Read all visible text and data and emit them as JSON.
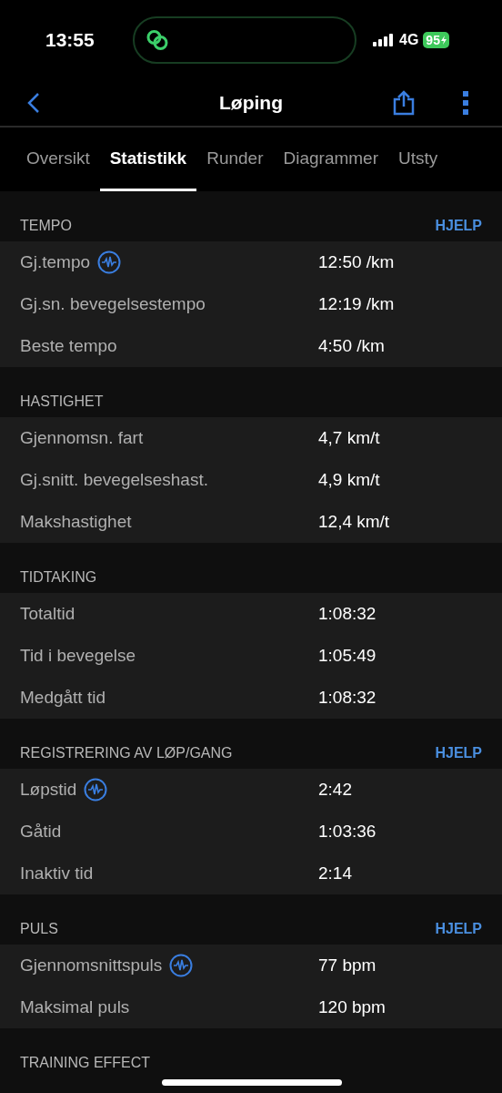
{
  "status_bar": {
    "time": "13:55",
    "network": "4G",
    "battery": "95"
  },
  "nav": {
    "title": "Løping"
  },
  "tabs": [
    {
      "label": "Oversikt",
      "selected": false
    },
    {
      "label": "Statistikk",
      "selected": true
    },
    {
      "label": "Runder",
      "selected": false
    },
    {
      "label": "Diagrammer",
      "selected": false
    },
    {
      "label": "Utsty",
      "selected": false
    }
  ],
  "sections": [
    {
      "title": "TEMPO",
      "help": "HJELP",
      "rows": [
        {
          "label": "Gj.tempo",
          "chart_icon": true,
          "value": "12:50 /km"
        },
        {
          "label": "Gj.sn. bevegelsestempo",
          "chart_icon": false,
          "value": "12:19 /km"
        },
        {
          "label": "Beste tempo",
          "chart_icon": false,
          "value": "4:50 /km"
        }
      ]
    },
    {
      "title": "HASTIGHET",
      "rows": [
        {
          "label": "Gjennomsn. fart",
          "chart_icon": false,
          "value": "4,7 km/t"
        },
        {
          "label": "Gj.snitt. bevegelseshast.",
          "chart_icon": false,
          "value": "4,9 km/t"
        },
        {
          "label": "Makshastighet",
          "chart_icon": false,
          "value": "12,4 km/t"
        }
      ]
    },
    {
      "title": "TIDTAKING",
      "rows": [
        {
          "label": "Totaltid",
          "chart_icon": false,
          "value": "1:08:32"
        },
        {
          "label": "Tid i bevegelse",
          "chart_icon": false,
          "value": "1:05:49"
        },
        {
          "label": "Medgått tid",
          "chart_icon": false,
          "value": "1:08:32"
        }
      ]
    },
    {
      "title": "REGISTRERING AV LØP/GANG",
      "help": "HJELP",
      "rows": [
        {
          "label": "Løpstid",
          "chart_icon": true,
          "value": "2:42"
        },
        {
          "label": "Gåtid",
          "chart_icon": false,
          "value": "1:03:36"
        },
        {
          "label": "Inaktiv tid",
          "chart_icon": false,
          "value": "2:14"
        }
      ]
    },
    {
      "title": "PULS",
      "help": "HJELP",
      "rows": [
        {
          "label": "Gjennomsnittspuls",
          "chart_icon": true,
          "value": "77 bpm"
        },
        {
          "label": "Maksimal puls",
          "chart_icon": false,
          "value": "120 bpm"
        }
      ]
    },
    {
      "title": "TRAINING EFFECT"
    }
  ]
}
